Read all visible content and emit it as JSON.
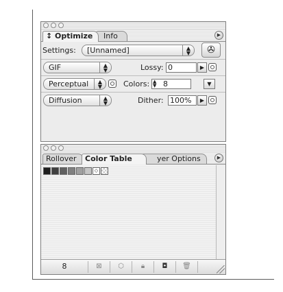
{
  "optimize_palette": {
    "tabs": [
      {
        "label": "↕ Optimize",
        "active": true
      },
      {
        "label": "Info",
        "active": false
      }
    ],
    "menu_icon": "triangle-right-icon",
    "settings": {
      "label": "Settings:",
      "value": "[Unnamed]",
      "wizard_icon": "optimize-wizard-icon"
    },
    "format": {
      "value": "GIF"
    },
    "lossy": {
      "label": "Lossy:",
      "value": "0"
    },
    "palette": {
      "value": "Perceptual"
    },
    "colors": {
      "label": "Colors:",
      "value": "8"
    },
    "dither_method": {
      "value": "Diffusion"
    },
    "dither": {
      "label": "Dither:",
      "value": "100%"
    }
  },
  "color_table_palette": {
    "tabs": [
      {
        "label": "Rollover",
        "active": false
      },
      {
        "label": "Color Table",
        "active": true
      },
      {
        "label": "yer Options",
        "active": false
      }
    ],
    "swatches": [
      "#1f1f1f",
      "#3f3f3f",
      "#606060",
      "#808080",
      "#a0a0a0",
      "#c6c6c6",
      "#ffffff",
      "#ffffff"
    ],
    "swatch_marks": [
      "diamond-icon",
      "transparency-icon"
    ],
    "color_count": "8",
    "bottom_icons": [
      "web-snap-icon",
      "web-cube-icon",
      "lock-icon",
      "new-color-icon",
      "trash-icon"
    ]
  }
}
